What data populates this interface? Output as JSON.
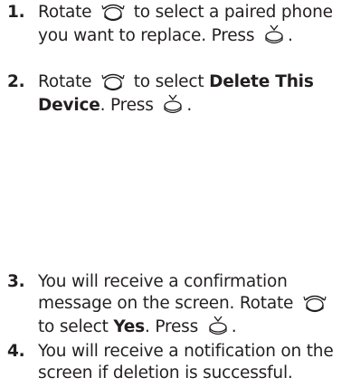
{
  "steps": [
    {
      "number": "1.",
      "text_before": "Rotate",
      "text_middle": "to select a paired phone you want to replace. Press",
      "text_end": "."
    },
    {
      "number": "2.",
      "text_before": "Rotate",
      "text_middle": "to select",
      "bold": "Delete This Device",
      "text_after_bold": ". Press",
      "text_end": "."
    },
    {
      "number": "3.",
      "text_before": "You will receive a confirmation message on the screen. Rotate",
      "text_middle": "to select",
      "bold": "Yes",
      "text_after_bold": ". Press",
      "text_end": "."
    },
    {
      "number": "4.",
      "text": "You will receive a notification on the screen if deletion is successful."
    }
  ],
  "icons": {
    "rotate": "selector-knob-rotate-icon",
    "press": "selector-knob-press-icon"
  }
}
